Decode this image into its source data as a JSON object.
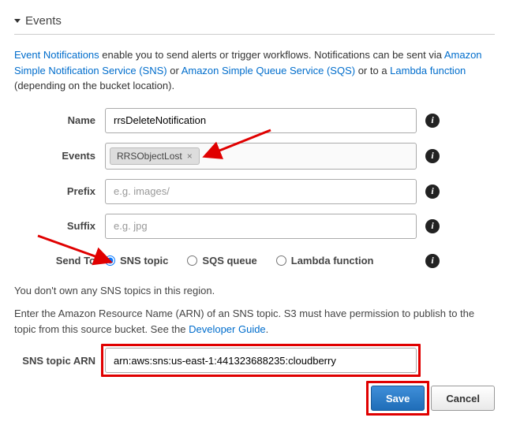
{
  "header": {
    "title": "Events"
  },
  "intro": {
    "pre": "Event Notifications",
    "text1": " enable you to send alerts or trigger workflows. Notifications can be sent via ",
    "link_sns": "Amazon Simple Notification Service (SNS)",
    "or": " or ",
    "link_sqs": "Amazon Simple Queue Service (SQS)",
    "text2": " or to a ",
    "link_lambda": "Lambda function",
    "text3": " (depending on the bucket location)."
  },
  "labels": {
    "name": "Name",
    "events": "Events",
    "prefix": "Prefix",
    "suffix": "Suffix",
    "send_to": "Send To",
    "arn": "SNS topic ARN"
  },
  "fields": {
    "name_value": "rrsDeleteNotification",
    "event_tag": "RRSObjectLost",
    "prefix_placeholder": "e.g. images/",
    "suffix_placeholder": "e.g. jpg",
    "arn_value": "arn:aws:sns:us-east-1:441323688235:cloudberry"
  },
  "send_to_options": {
    "sns": "SNS topic",
    "sqs": "SQS queue",
    "lambda": "Lambda function",
    "selected": "sns"
  },
  "notes": {
    "no_topics": "You don't own any SNS topics in this region.",
    "arn_help_pre": "Enter the Amazon Resource Name (ARN) of an SNS topic. S3 must have permission to publish to the topic from this source bucket. See the ",
    "dev_guide": "Developer Guide",
    "dot": "."
  },
  "buttons": {
    "save": "Save",
    "cancel": "Cancel"
  },
  "info_glyph": "i",
  "chip_close": "×"
}
